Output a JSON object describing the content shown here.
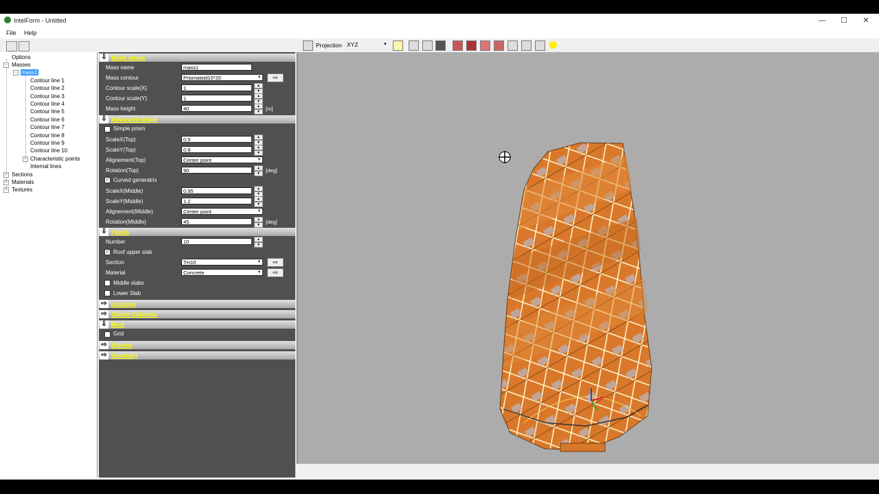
{
  "window": {
    "title": "IntelForm - Untitled",
    "minimize": "—",
    "maximize": "☐",
    "close": "✕"
  },
  "menu": {
    "file": "File",
    "help": "Help"
  },
  "tree": {
    "options": "Options",
    "masses": "Masses",
    "mass1": "mass1",
    "contours": [
      "Contour line 1",
      "Contour line 2",
      "Contour line 3",
      "Contour line 4",
      "Contour line 5",
      "Contour line 6",
      "Contour line 7",
      "Contour line 8",
      "Contour line 9",
      "Contour line 10"
    ],
    "characteristic_points": "Characteristic points",
    "internal_lines": "Internal lines",
    "sections": "Sections",
    "materials": "Materials",
    "textures": "Textures"
  },
  "panel": {
    "basic_shape": {
      "title": "Basic shape",
      "mass_name_label": "Mass name",
      "mass_name": "mass1",
      "mass_contour_label": "Mass contour",
      "mass_contour": "Prismatoid10*20",
      "contour_scale_x_label": "Contour scale(X)",
      "contour_scale_x": "1",
      "contour_scale_y_label": "Contour scale(Y)",
      "contour_scale_y": "1",
      "mass_height_label": "Mass height",
      "mass_height": "40",
      "mass_height_unit": "[m]"
    },
    "advanced_shape": {
      "title": "Advanced shape",
      "simple_prism": "Simple prism",
      "scalex_top_label": "ScaleX(Top)",
      "scalex_top": "0.5",
      "scaley_top_label": "ScaleY(Top)",
      "scaley_top": "0.8",
      "alignment_top_label": "Alignement(Top)",
      "alignment_top": "Center point",
      "rotation_top_label": "Rotation(Top)",
      "rotation_top": "90",
      "rotation_top_unit": "[deg]",
      "curved_generatrix": "Curved generatrix",
      "scalex_middle_label": "ScaleX(Middle)",
      "scalex_middle": "0.95",
      "scaley_middle_label": "ScaleY(Middle)",
      "scaley_middle": "1.2",
      "alignment_middle_label": "Alignement(Middle)",
      "alignment_middle": "Center point",
      "rotation_middle_label": "Rotation(Middle)",
      "rotation_middle": "45",
      "rotation_middle_unit": "[deg]"
    },
    "floors": {
      "title": "Floors",
      "number_label": "Number",
      "number": "10",
      "roof_upper_slab": "Roof upper slab",
      "section_label": "Section",
      "section": "TH10",
      "material_label": "Material",
      "material": "Concrete",
      "middle_slabs": "Middle slabs",
      "lower_slab": "Lower Slab"
    },
    "location": {
      "title": "Location"
    },
    "corner_columns": {
      "title": "Corner Columns"
    },
    "roof": {
      "title": "Roof",
      "grid": "Grid"
    },
    "extents": {
      "title": "Extents"
    },
    "summary": {
      "title": "Summary"
    }
  },
  "viewport_toolbar": {
    "projection_label": "Projection",
    "projection_value": "XYZ"
  },
  "colors": {
    "panel_bg": "#505050",
    "section_title": "#ffff00",
    "building": "#d9782a",
    "viewport_bg": "#acacac"
  }
}
